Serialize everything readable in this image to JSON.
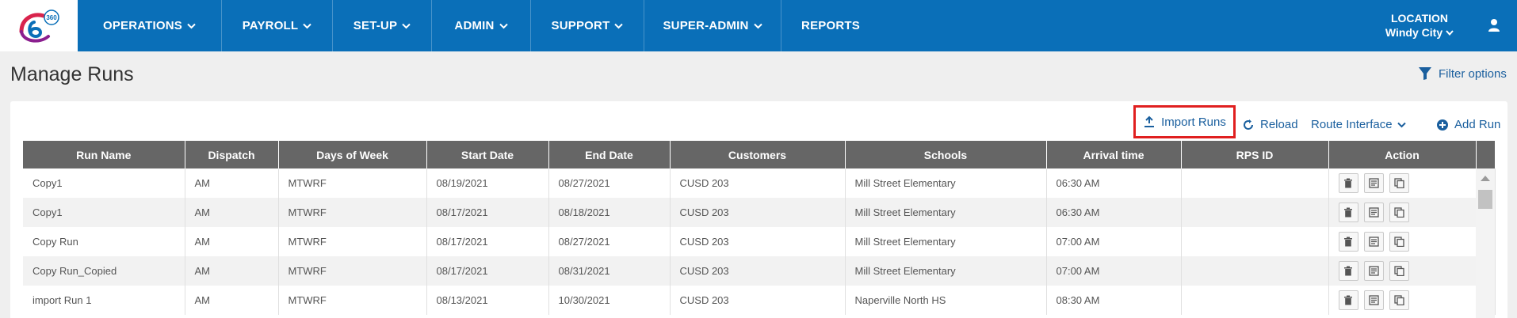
{
  "nav": {
    "logo_text": "360",
    "items": [
      {
        "label": "OPERATIONS",
        "has_dropdown": true
      },
      {
        "label": "PAYROLL",
        "has_dropdown": true
      },
      {
        "label": "SET-UP",
        "has_dropdown": true
      },
      {
        "label": "ADMIN",
        "has_dropdown": true
      },
      {
        "label": "SUPPORT",
        "has_dropdown": true
      },
      {
        "label": "SUPER-ADMIN",
        "has_dropdown": true
      },
      {
        "label": "REPORTS",
        "has_dropdown": false
      }
    ],
    "location_label": "LOCATION",
    "location_value": "Windy City"
  },
  "page": {
    "title": "Manage Runs",
    "filter_label": "Filter options"
  },
  "toolbar": {
    "import_label": "Import Runs",
    "reload_label": "Reload",
    "route_label": "Route Interface",
    "add_label": "Add Run"
  },
  "table": {
    "columns": [
      "Run Name",
      "Dispatch",
      "Days of Week",
      "Start Date",
      "End Date",
      "Customers",
      "Schools",
      "Arrival time",
      "RPS ID",
      "Action"
    ],
    "rows": [
      [
        "Copy1",
        "AM",
        "MTWRF",
        "08/19/2021",
        "08/27/2021",
        "CUSD 203",
        "Mill Street Elementary",
        "06:30 AM",
        ""
      ],
      [
        "Copy1",
        "AM",
        "MTWRF",
        "08/17/2021",
        "08/18/2021",
        "CUSD 203",
        "Mill Street Elementary",
        "06:30 AM",
        ""
      ],
      [
        "Copy Run",
        "AM",
        "MTWRF",
        "08/17/2021",
        "08/27/2021",
        "CUSD 203",
        "Mill Street Elementary",
        "07:00 AM",
        ""
      ],
      [
        "Copy Run_Copied",
        "AM",
        "MTWRF",
        "08/17/2021",
        "08/31/2021",
        "CUSD 203",
        "Mill Street Elementary",
        "07:00 AM",
        ""
      ],
      [
        "import Run 1",
        "AM",
        "MTWRF",
        "08/13/2021",
        "10/30/2021",
        "CUSD 203",
        "Naperville North HS",
        "08:30 AM",
        ""
      ]
    ]
  },
  "colors": {
    "nav_bg": "#0a6fb8",
    "link": "#1a5f9e",
    "header_bg": "#666666",
    "highlight": "#e01f1f"
  }
}
